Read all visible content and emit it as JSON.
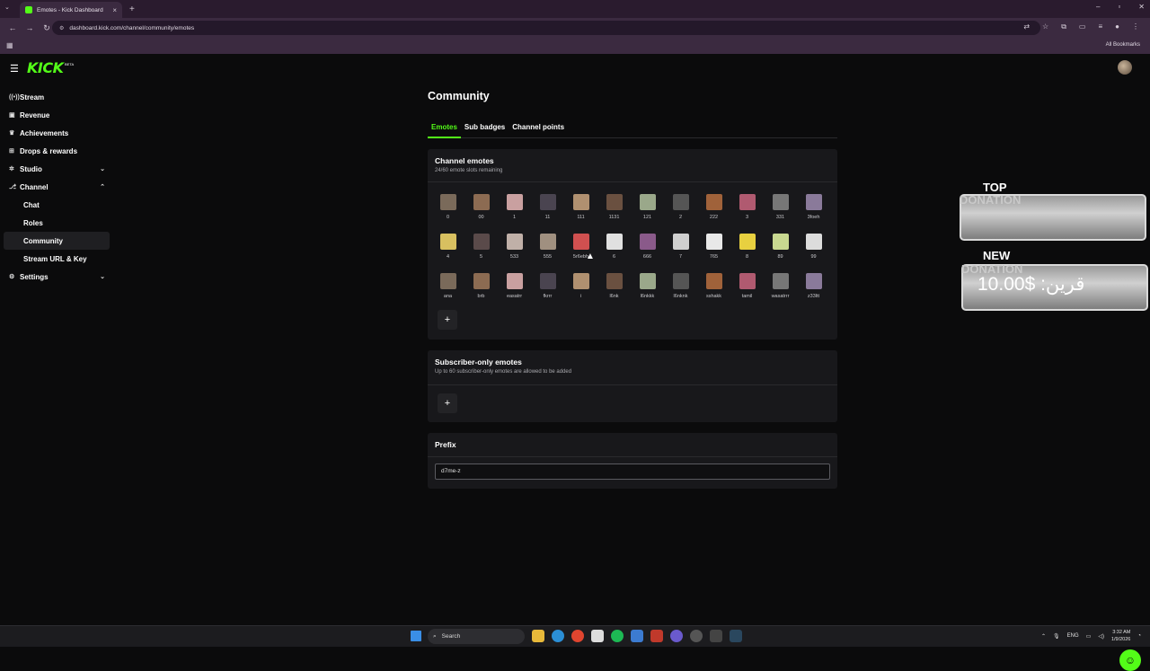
{
  "browser": {
    "tab_title": "Emotes - Kick Dashboard",
    "url": "dashboard.kick.com/channel/community/emotes",
    "all_bookmarks": "All Bookmarks"
  },
  "header": {
    "logo": "KICK",
    "logo_badge": "BETA"
  },
  "sidebar": {
    "items": [
      {
        "label": "Stream",
        "icon": "broadcast-icon"
      },
      {
        "label": "Revenue",
        "icon": "wallet-icon"
      },
      {
        "label": "Achievements",
        "icon": "trophy-icon"
      },
      {
        "label": "Drops & rewards",
        "icon": "gift-icon"
      },
      {
        "label": "Studio",
        "icon": "studio-icon"
      },
      {
        "label": "Channel",
        "icon": "channel-icon"
      },
      {
        "label": "Chat"
      },
      {
        "label": "Roles"
      },
      {
        "label": "Community"
      },
      {
        "label": "Stream URL & Key"
      },
      {
        "label": "Settings",
        "icon": "gear-icon"
      }
    ]
  },
  "main": {
    "title": "Community",
    "tabs": [
      "Emotes",
      "Sub badges",
      "Channel points"
    ],
    "channel_emotes": {
      "title": "Channel emotes",
      "subtitle": "24/60 emote slots remaining",
      "rows": [
        [
          "0",
          "00",
          "1",
          "11",
          "111",
          "1131",
          "121",
          "2",
          "222",
          "3",
          "331",
          "3foeh"
        ],
        [
          "4",
          "5",
          "533",
          "555",
          "5r6ebh",
          "6",
          "666",
          "7",
          "765",
          "8",
          "89",
          "99"
        ],
        [
          "ana",
          "brb",
          "easatrr",
          "fkrrr",
          "i",
          "l6nk",
          "l6nkkk",
          "l6nknk",
          "sshakk",
          "tamil",
          "wasatrrr",
          "z33ltt"
        ]
      ]
    },
    "subscriber_emotes": {
      "title": "Subscriber-only emotes",
      "subtitle": "Up to 60 subscriber-only emotes are allowed to be added"
    },
    "prefix": {
      "title": "Prefix",
      "value": "d7me-z"
    },
    "add_symbol": "+"
  },
  "overlay": {
    "top_donation": {
      "line1": "TOP",
      "line2": "DONATION"
    },
    "new_donation": {
      "line1": "NEW",
      "line2": "DONATION",
      "amount": "قرين: $10.00"
    }
  },
  "taskbar": {
    "search": "Search",
    "lang": "ENG",
    "time": "3:32 AM",
    "date": "1/9/2026"
  },
  "colors": {
    "accent": "#53fc18",
    "bg": "#0b0b0c",
    "card": "#18181b"
  }
}
